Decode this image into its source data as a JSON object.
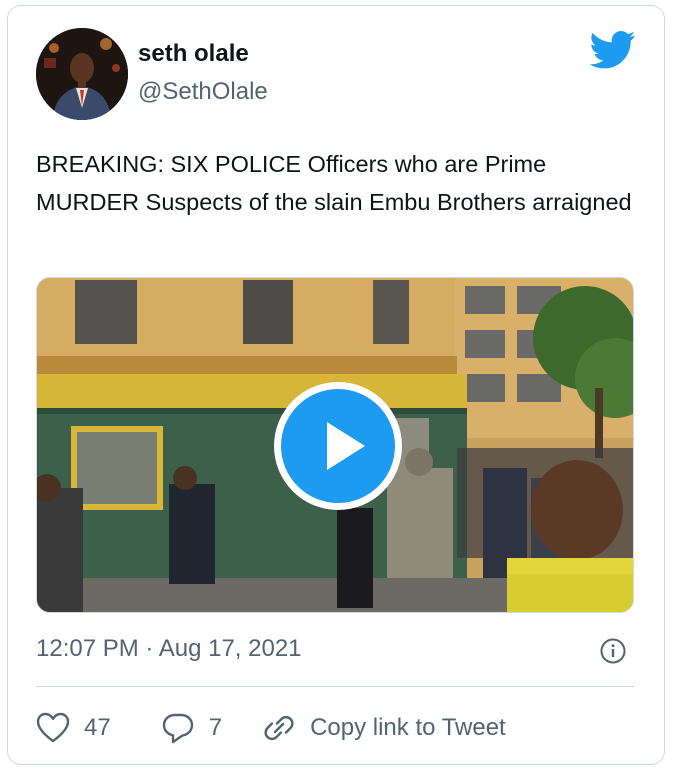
{
  "author": {
    "display_name": "seth olale",
    "handle": "@SethOlale",
    "avatar_icon": "profile-photo",
    "platform_icon": "twitter-bird-icon",
    "brand_color": "#1d9bf0"
  },
  "tweet": {
    "text": "BREAKING: SIX POLICE Officers who are Prime MURDER Suspects of the slain Embu Brothers arraigned",
    "media_type": "video",
    "play_icon": "play-icon",
    "timestamp": "12:07 PM · Aug 17, 2021",
    "info_icon": "info-icon"
  },
  "actions": {
    "likes": "47",
    "replies": "7",
    "copy_link_label": "Copy link to Tweet"
  }
}
